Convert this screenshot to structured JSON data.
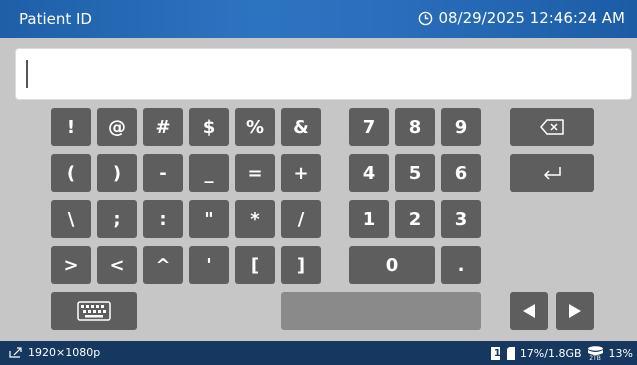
{
  "header": {
    "title": "Patient ID",
    "datetime": "08/29/2025 12:46:24 AM"
  },
  "input": {
    "value": ""
  },
  "keyboard": {
    "symbols": [
      "!",
      "@",
      "#",
      "$",
      "%",
      "&",
      "(",
      ")",
      "-",
      "_",
      "=",
      "+",
      "\\",
      ";",
      ":",
      "\"",
      "*",
      "/",
      ">",
      "<",
      "^",
      "'",
      "[",
      "]"
    ],
    "digits": [
      "7",
      "8",
      "9",
      "4",
      "5",
      "6",
      "1",
      "2",
      "3",
      "0",
      "."
    ]
  },
  "footer": {
    "resolution": "1920×1080p",
    "sd_slot": "1",
    "sd_usage": "17%/1.8GB",
    "storage_label": "2TB",
    "storage_usage": "13%"
  },
  "colors": {
    "header": "#2a6fbd",
    "footer": "#16375f",
    "key": "#5e5e5e",
    "background": "#c6c6c6"
  }
}
